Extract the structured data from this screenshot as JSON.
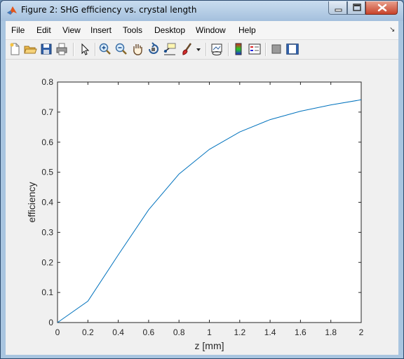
{
  "window": {
    "title": "Figure 2: SHG efficiency vs. crystal length"
  },
  "menu": {
    "items": [
      {
        "id": "file",
        "label": "File"
      },
      {
        "id": "edit",
        "label": "Edit"
      },
      {
        "id": "view",
        "label": "View"
      },
      {
        "id": "insert",
        "label": "Insert"
      },
      {
        "id": "tools",
        "label": "Tools"
      },
      {
        "id": "desktop",
        "label": "Desktop"
      },
      {
        "id": "window",
        "label": "Window"
      },
      {
        "id": "help",
        "label": "Help"
      }
    ]
  },
  "toolbar": {
    "icons": [
      "new-figure-icon",
      "open-file-icon",
      "save-icon",
      "print-icon",
      "edit-plot-arrow-icon",
      "zoom-in-icon",
      "zoom-out-icon",
      "pan-hand-icon",
      "rotate-3d-icon",
      "data-cursor-icon",
      "brush-icon",
      "brush-dropdown-icon",
      "link-plot-icon",
      "insert-colorbar-icon",
      "insert-legend-icon",
      "hide-plot-tools-icon",
      "show-plot-tools-icon"
    ]
  },
  "colors": {
    "line": "#0072bd",
    "axes_bg": "#ffffff",
    "figure_bg": "#f0f0f0"
  },
  "chart_data": {
    "type": "line",
    "title": "",
    "xlabel": "z [mm]",
    "ylabel": "efficiency",
    "xlim": [
      0,
      2
    ],
    "ylim": [
      0,
      0.8
    ],
    "xticks": [
      "0",
      "0.2",
      "0.4",
      "0.6",
      "0.8",
      "1",
      "1.2",
      "1.4",
      "1.6",
      "1.8",
      "2"
    ],
    "yticks": [
      "0",
      "0.1",
      "0.2",
      "0.3",
      "0.4",
      "0.5",
      "0.6",
      "0.7",
      "0.8"
    ],
    "grid": false,
    "series": [
      {
        "x": [
          0,
          0.2,
          0.4,
          0.6,
          0.8,
          1.0,
          1.2,
          1.4,
          1.6,
          1.8,
          2.0
        ],
        "y": [
          0,
          0.071,
          0.225,
          0.375,
          0.494,
          0.576,
          0.634,
          0.675,
          0.703,
          0.724,
          0.741
        ]
      }
    ]
  }
}
